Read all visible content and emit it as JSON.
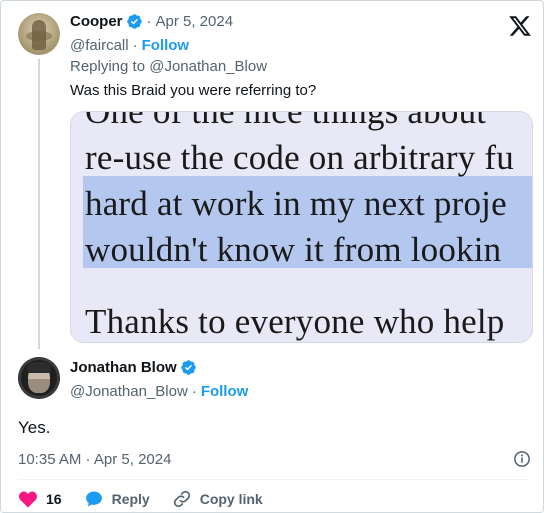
{
  "parent_tweet": {
    "author_name": "Cooper",
    "separator": "·",
    "date": "Apr 5, 2024",
    "handle": "@faircall",
    "follow_sep": "·",
    "follow_label": "Follow",
    "replying_prefix": "Replying to",
    "replying_handle": "@Jonathan_Blow",
    "text": "Was this Braid you were referring to?",
    "image_lines": [
      "One of the nice things about",
      "re-use the code on arbitrary fu",
      "hard at work in my next proje",
      "wouldn't know it from lookin",
      "Thanks to everyone who help"
    ]
  },
  "main_tweet": {
    "author_name": "Jonathan Blow",
    "handle": "@Jonathan_Blow",
    "follow_sep": "·",
    "follow_label": "Follow",
    "text": "Yes.",
    "timestamp": "10:35 AM · Apr 5, 2024"
  },
  "actions": {
    "like_count": "16",
    "reply_label": "Reply",
    "copy_label": "Copy link"
  },
  "icons": {
    "brand": "x-logo-icon",
    "verified": "verified-badge-icon",
    "info": "info-icon",
    "like": "heart-icon",
    "reply": "reply-bubble-icon",
    "copy": "link-icon"
  },
  "colors": {
    "accent": "#1d9bf0",
    "like": "#f91880",
    "muted": "#536471",
    "text": "#0f1419",
    "highlight": "#b4c8ef"
  }
}
